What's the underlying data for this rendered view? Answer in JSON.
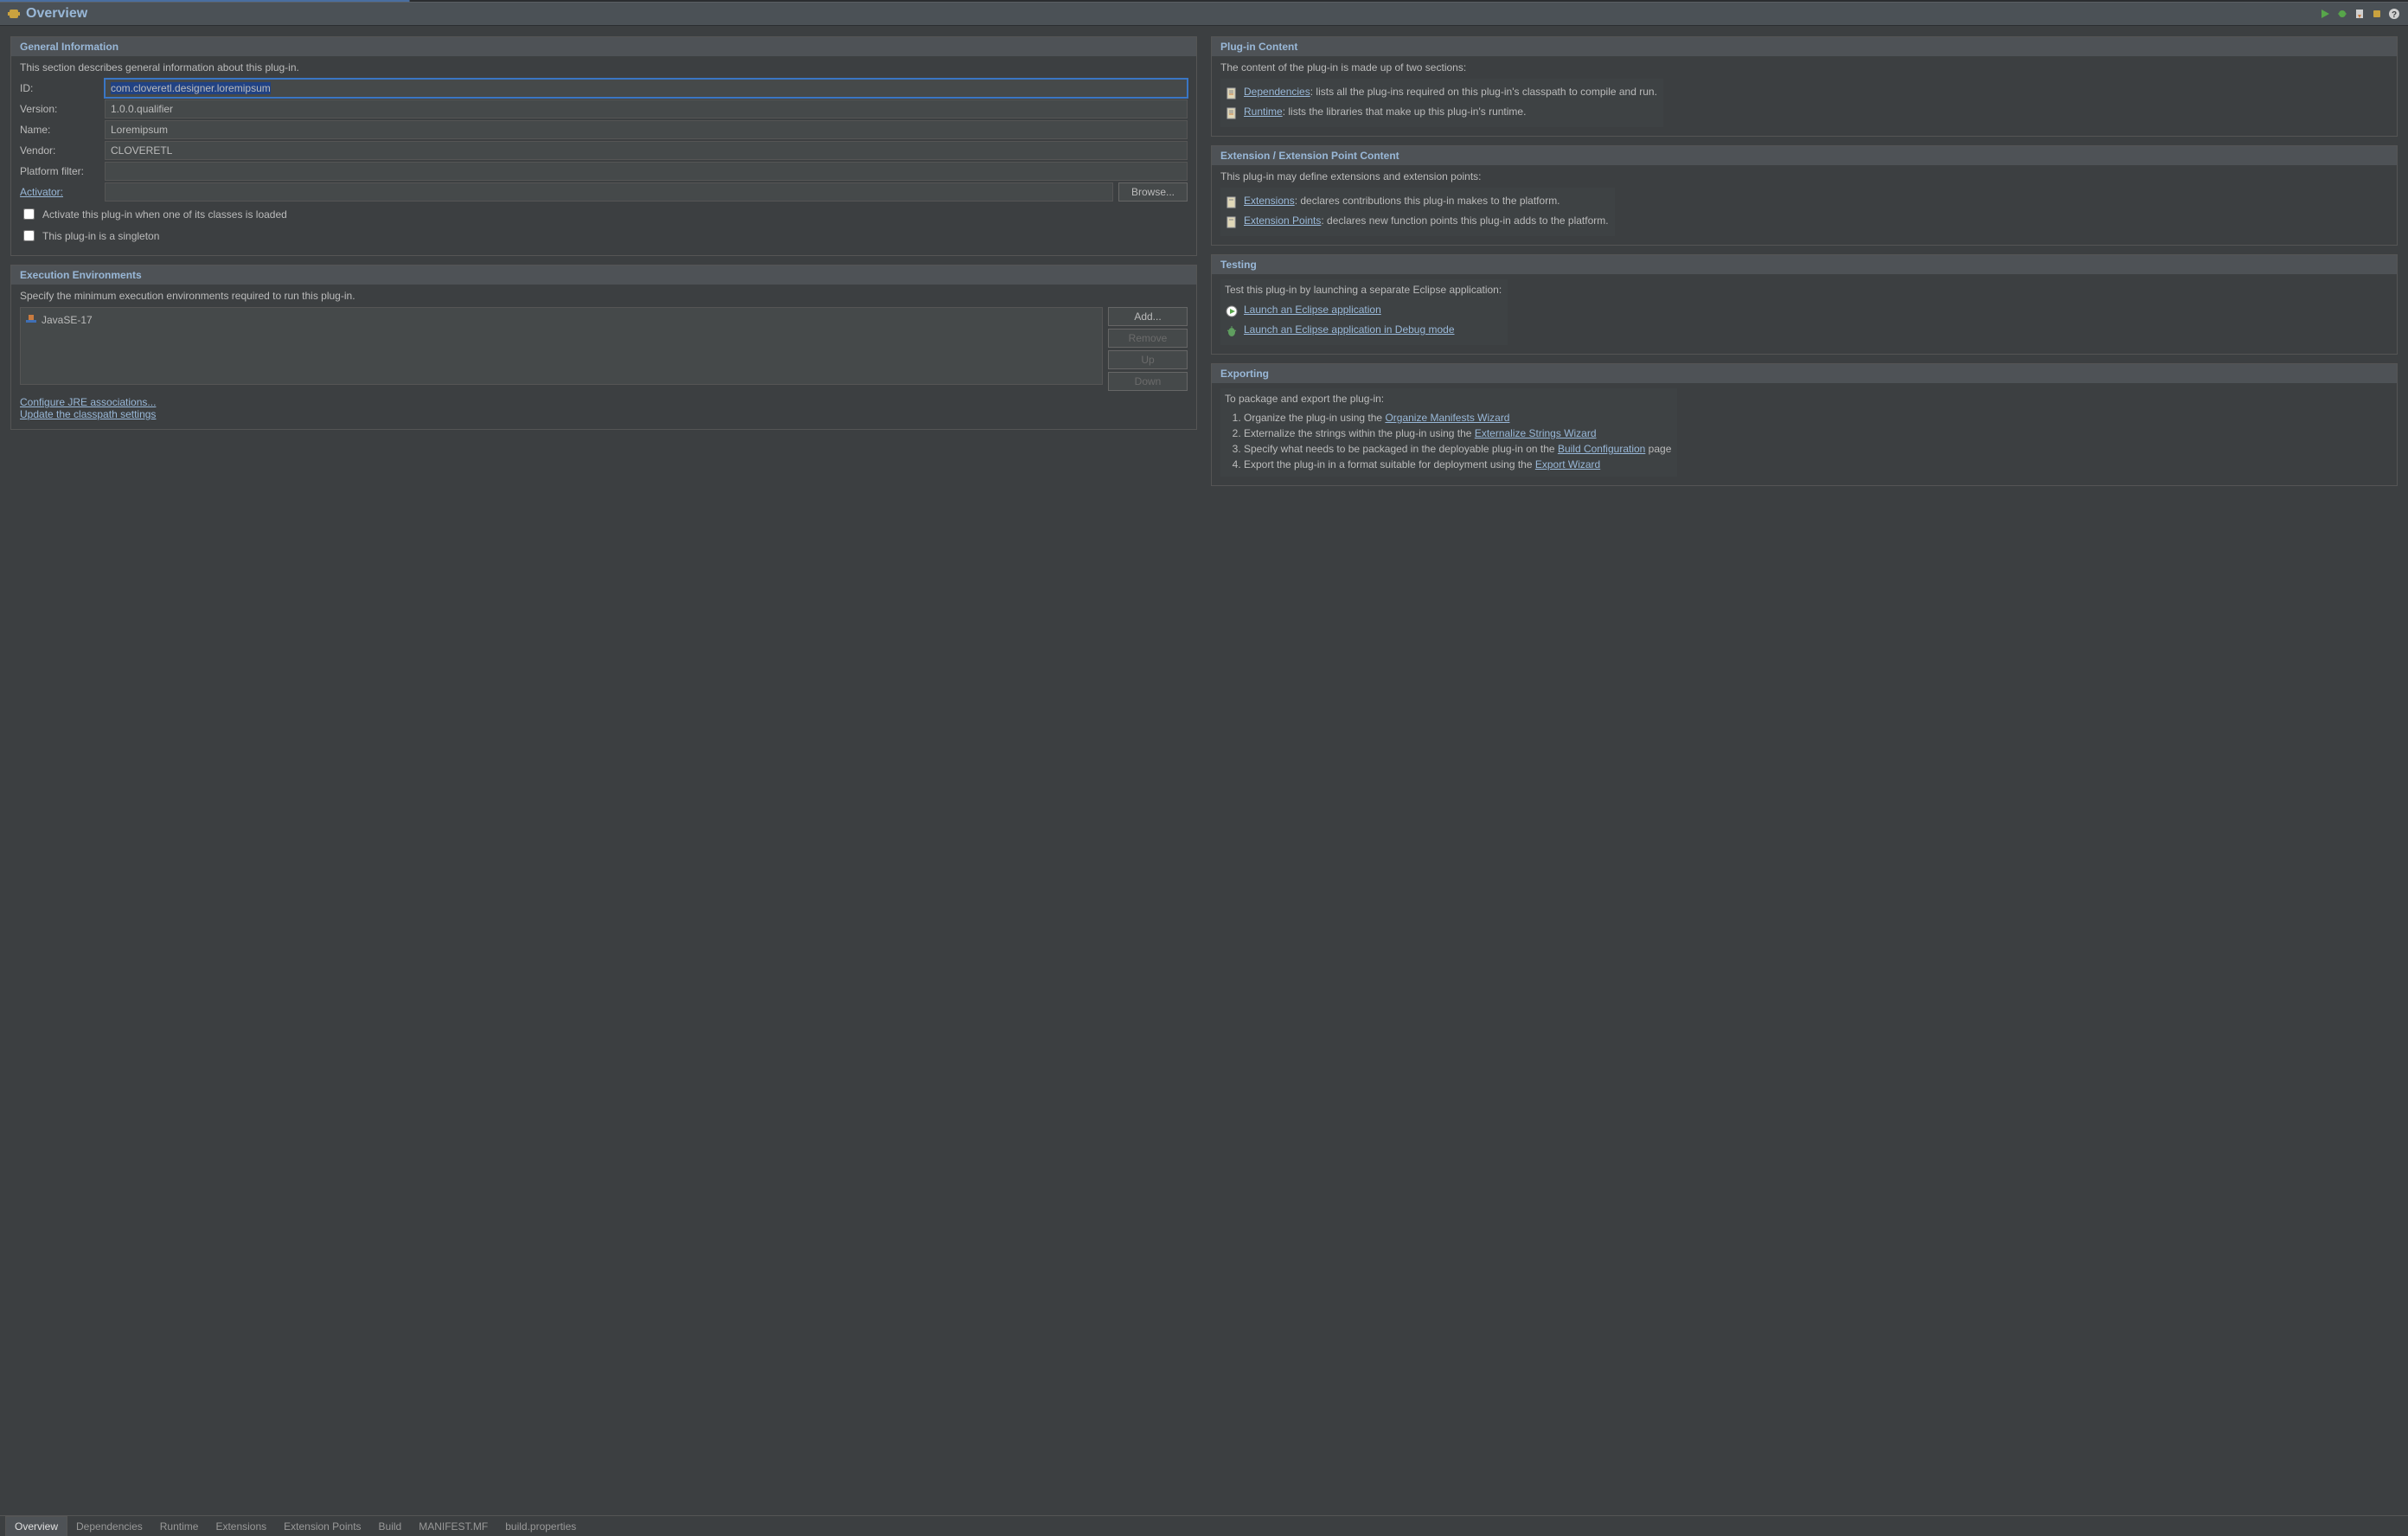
{
  "title": "Overview",
  "general": {
    "title": "General Information",
    "desc": "This section describes general information about this plug-in.",
    "id_label": "ID:",
    "id_value": "com.cloveretl.designer.loremipsum",
    "version_label": "Version:",
    "version_value": "1.0.0.qualifier",
    "name_label": "Name:",
    "name_value": "Loremipsum",
    "vendor_label": "Vendor:",
    "vendor_value": "CLOVERETL",
    "platformfilter_label": "Platform filter:",
    "platformfilter_value": "",
    "activator_label": "Activator:",
    "activator_value": "",
    "browse": "Browse...",
    "cb_activate": "Activate this plug-in when one of its classes is loaded",
    "cb_singleton": "This plug-in is a singleton"
  },
  "exec": {
    "title": "Execution Environments",
    "desc": "Specify the minimum execution environments required to run this plug-in.",
    "items": [
      "JavaSE-17"
    ],
    "add": "Add...",
    "remove": "Remove",
    "up": "Up",
    "down": "Down",
    "jre_link": "Configure JRE associations...",
    "cp_link": "Update the classpath settings"
  },
  "content": {
    "title": "Plug-in Content",
    "desc": "The content of the plug-in is made up of two sections:",
    "dep_link": "Dependencies",
    "dep_text": ": lists all the plug-ins required on this plug-in's classpath to compile and run.",
    "rt_link": "Runtime",
    "rt_text": ": lists the libraries that make up this plug-in's runtime."
  },
  "ext": {
    "title": "Extension / Extension Point Content",
    "desc": "This plug-in may define extensions and extension points:",
    "ext_link": "Extensions",
    "ext_text": ": declares contributions this plug-in makes to the platform.",
    "ep_link": "Extension Points",
    "ep_text": ": declares new function points this plug-in adds to the platform."
  },
  "testing": {
    "title": "Testing",
    "desc": "Test this plug-in by launching a separate Eclipse application:",
    "launch": "Launch an Eclipse application",
    "debug": "Launch an Eclipse application in Debug mode"
  },
  "exporting": {
    "title": "Exporting",
    "desc": "To package and export the plug-in:",
    "i1_pre": "Organize the plug-in using the ",
    "i1_link": "Organize Manifests Wizard",
    "i2_pre": "Externalize the strings within the plug-in using the ",
    "i2_link": "Externalize Strings Wizard",
    "i3_pre": "Specify what needs to be packaged in the deployable plug-in on the ",
    "i3_link": "Build Configuration",
    "i3_post": " page",
    "i4_pre": "Export the plug-in in a format suitable for deployment using the ",
    "i4_link": "Export Wizard"
  },
  "tabs": [
    "Overview",
    "Dependencies",
    "Runtime",
    "Extensions",
    "Extension Points",
    "Build",
    "MANIFEST.MF",
    "build.properties"
  ]
}
